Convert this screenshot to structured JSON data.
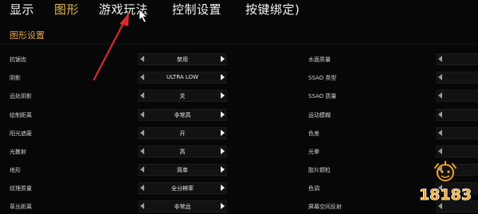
{
  "tabs": [
    {
      "label": "显示"
    },
    {
      "label": "图形"
    },
    {
      "label": "游戏玩法"
    },
    {
      "label": "控制设置"
    },
    {
      "label": "按键绑定)"
    }
  ],
  "section_title": "图形设置",
  "left_settings": [
    {
      "label": "抗锯齿",
      "value": "禁用"
    },
    {
      "label": "阴影",
      "value": "ULTRA LOW"
    },
    {
      "label": "远处阴影",
      "value": "关"
    },
    {
      "label": "绘制距离",
      "value": "非常高"
    },
    {
      "label": "阳光遮蔽",
      "value": "开"
    },
    {
      "label": "光散射",
      "value": "高"
    },
    {
      "label": "地形",
      "value": "简单"
    },
    {
      "label": "纹理质量",
      "value": "全分辨率"
    },
    {
      "label": "草丛距离",
      "value": "非常远"
    }
  ],
  "right_settings": [
    {
      "label": "水面质量"
    },
    {
      "label": "SSAO 类型"
    },
    {
      "label": "SSAO 质量"
    },
    {
      "label": "运动模糊"
    },
    {
      "label": "色差"
    },
    {
      "label": "光晕"
    },
    {
      "label": "胶片颗粒"
    },
    {
      "label": "色调"
    },
    {
      "label": "屏幕空间反射"
    }
  ],
  "logo": {
    "text": "18183"
  },
  "colors": {
    "active_tab": "#e7b552",
    "accent": "#e2a64a",
    "annotation": "#d9292a",
    "logo_orange": "#f0a12a"
  }
}
